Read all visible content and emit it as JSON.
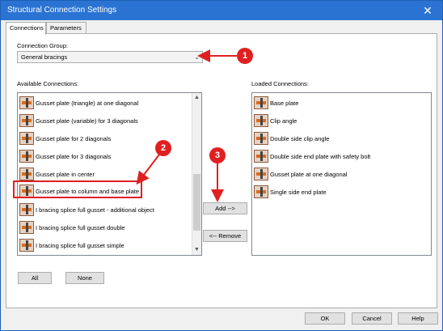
{
  "window": {
    "title": "Structural Connection Settings",
    "close_icon": "close-icon"
  },
  "tabs": [
    {
      "label": "Connections"
    },
    {
      "label": "Parameters"
    }
  ],
  "connection_group": {
    "label": "Connection Group:",
    "value": "General bracings"
  },
  "available": {
    "label": "Available Connections:",
    "items": [
      "Gusset plate (triangle) at one diagonal",
      "Gusset plate (variable) for 3 diagonals",
      "Gusset plate for 2 diagonals",
      "Gusset plate for 3 diagonals",
      "Gusset plate in center",
      "Gusset plate to column and base plate",
      "I bracing splice full gusset - additional object",
      "I bracing splice full gusset double",
      "I bracing splice full gusset simple"
    ]
  },
  "loaded": {
    "label": "Loaded Connections:",
    "items": [
      "Base plate",
      "Clip angle",
      "Double side clip angle",
      "Double side end plate with safety bolt",
      "Gusset plate at one diagonal",
      "Single side end plate"
    ]
  },
  "buttons": {
    "add": "Add -->",
    "remove": "<-- Remove",
    "all": "All",
    "none": "None",
    "ok": "OK",
    "cancel": "Cancel",
    "help": "Help"
  },
  "callouts": [
    "1",
    "2",
    "3"
  ]
}
